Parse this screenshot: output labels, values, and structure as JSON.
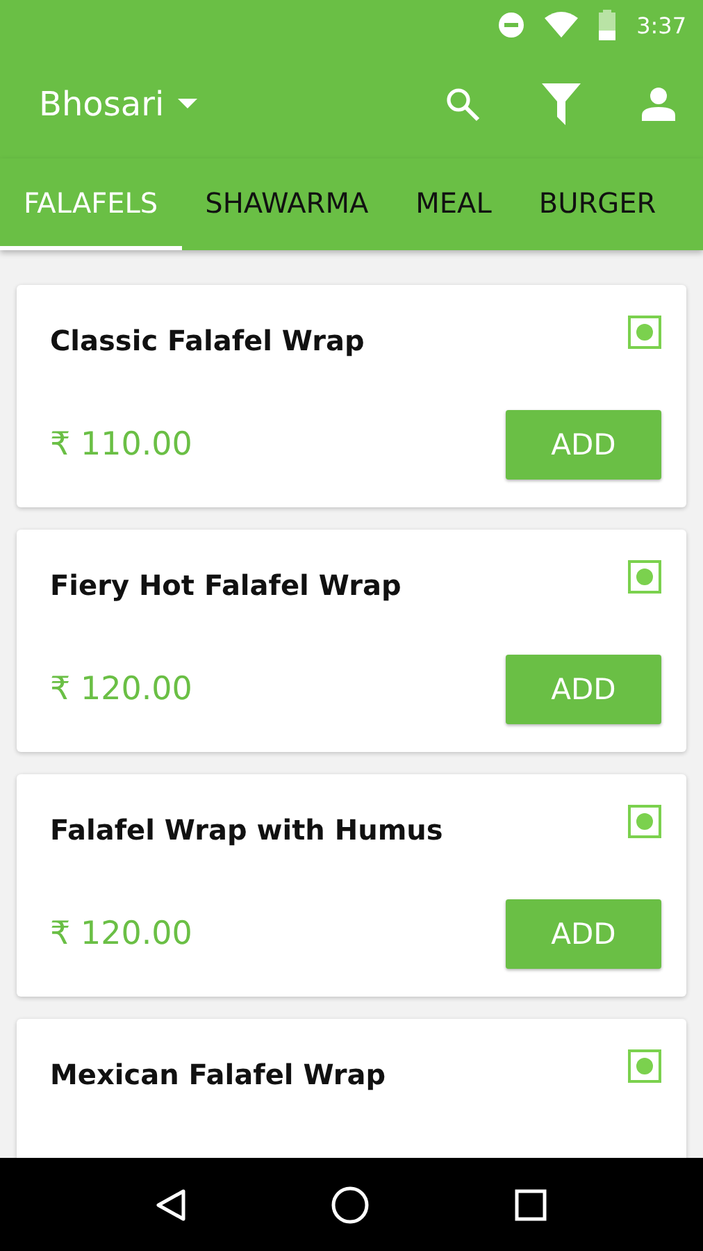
{
  "status_bar": {
    "time": "3:37"
  },
  "app_bar": {
    "location": "Bhosari"
  },
  "tabs": [
    {
      "label": "FALAFELS",
      "selected": true
    },
    {
      "label": "SHAWARMA",
      "selected": false
    },
    {
      "label": "MEAL",
      "selected": false
    },
    {
      "label": "BURGER",
      "selected": false
    }
  ],
  "items": [
    {
      "name": "Classic Falafel Wrap",
      "veg": true,
      "price": "₹ 110.00",
      "button": "ADD"
    },
    {
      "name": "Fiery Hot Falafel Wrap",
      "veg": true,
      "price": "₹ 120.00",
      "button": "ADD"
    },
    {
      "name": "Falafel Wrap with Humus",
      "veg": true,
      "price": "₹ 120.00",
      "button": "ADD"
    },
    {
      "name": "Mexican Falafel Wrap",
      "veg": true
    }
  ]
}
